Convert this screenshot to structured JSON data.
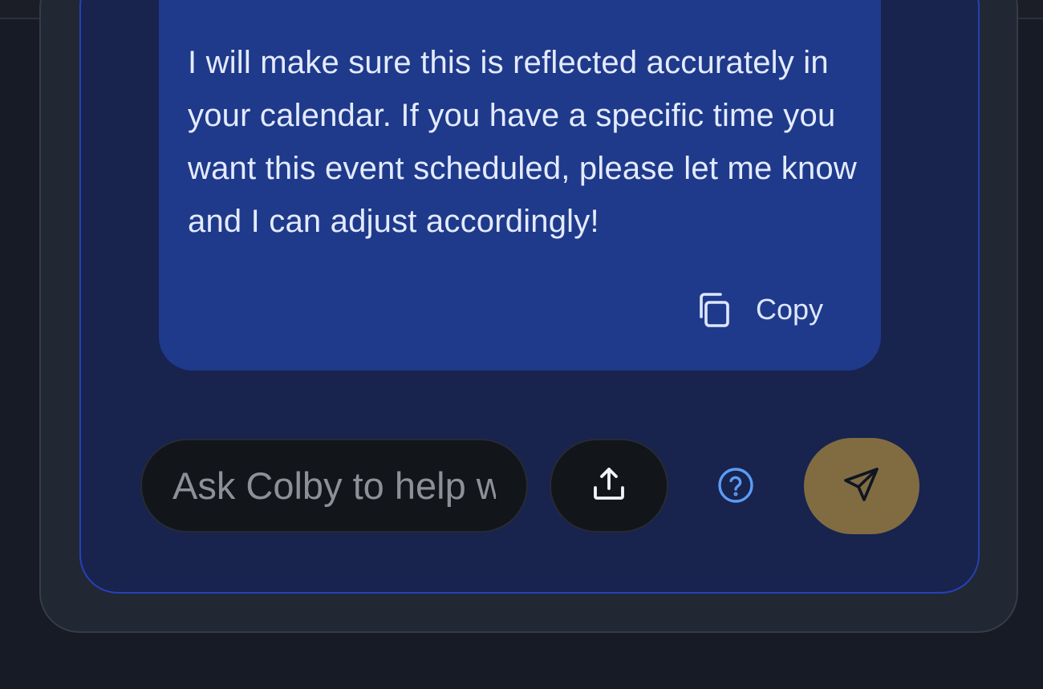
{
  "message": {
    "text": "I will make sure this is reflected accurately in your calendar. If you have a specific time you want this event scheduled, please let me know and I can adjust accordingly!",
    "copy_label": "Copy",
    "copy_icon": "copy-icon"
  },
  "composer": {
    "placeholder": "Ask Colby to help with your calendar",
    "upload_icon": "upload-icon",
    "help_icon": "help-circle-icon",
    "send_icon": "send-icon"
  },
  "colors": {
    "panel": "#18234e",
    "panel_border": "#2541b8",
    "bubble": "#1f3a8a",
    "send_button": "#816c42",
    "help_icon": "#5b9cf5"
  }
}
